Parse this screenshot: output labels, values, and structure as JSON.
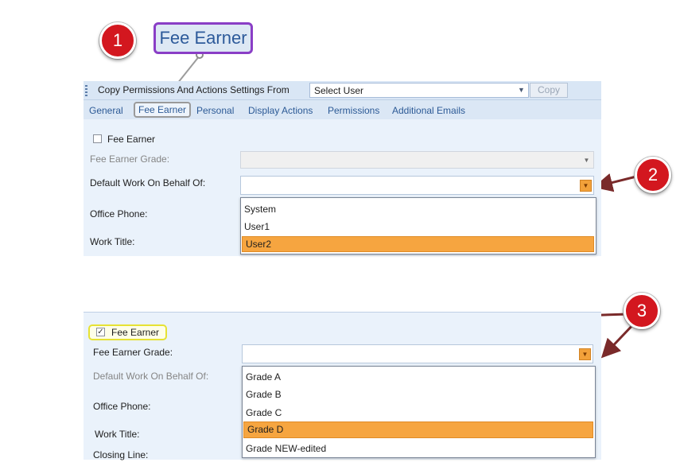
{
  "callouts": {
    "one": "1",
    "two": "2",
    "three": "3"
  },
  "tab_zoom_label": "Fee Earner",
  "toolbar": {
    "copy_label": "Copy Permissions And Actions Settings From",
    "user_select_value": "Select User",
    "copy_button": "Copy"
  },
  "tabs": [
    "General",
    "Fee Earner",
    "Personal",
    "Display Actions",
    "Permissions",
    "Additional Emails"
  ],
  "panel1": {
    "fee_earner_checkbox": "Fee Earner",
    "fee_earner_grade_label": "Fee Earner Grade:",
    "default_work_label": "Default Work On Behalf Of:",
    "office_phone_label": "Office Phone:",
    "work_title_label": "Work Title:",
    "dropdown_options": [
      "System",
      "User1",
      "User2"
    ],
    "selected_option": "User2"
  },
  "panel2": {
    "fee_earner_checkbox": "Fee Earner",
    "fee_earner_grade_label": "Fee Earner Grade:",
    "default_work_label": "Default Work On Behalf Of:",
    "office_phone_label": "Office Phone:",
    "work_title_label": "Work Title:",
    "closing_line_label": "Closing Line:",
    "dropdown_options": [
      "Grade A",
      "Grade B",
      "Grade C",
      "Grade D",
      "Grade NEW-edited"
    ],
    "selected_option": "Grade D"
  },
  "colors": {
    "badge": "#d3171f",
    "highlight": "#f6a540",
    "callout_border": "#8a3ec6",
    "checkbox_highlight": "#e6e233",
    "arrow": "#7a2a2a"
  }
}
